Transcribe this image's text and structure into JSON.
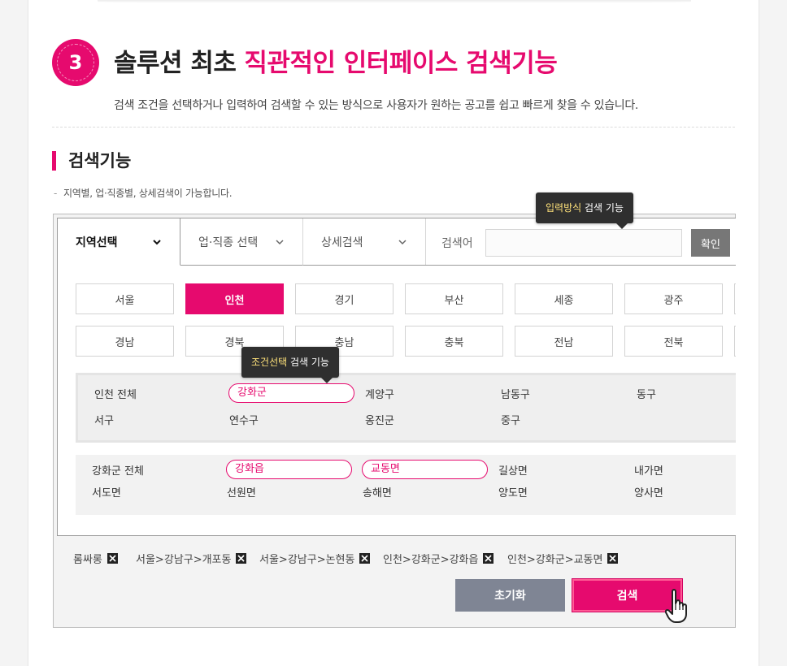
{
  "header": {
    "step_number": "3",
    "title_dark": "솔루션 최초",
    "title_accent": "직관적인 인터페이스 검색기능",
    "description": "검색 조건을 선택하거나 입력하여 검색할 수 있는 방식으로 사용자가 원하는 공고를 쉽고 빠르게 찾을 수 있습니다."
  },
  "section": {
    "title": "검색기능",
    "subtitle": "지역별, 업·직종별, 상세검색이 가능합니다."
  },
  "tabs": [
    {
      "label": "지역선택"
    },
    {
      "label": "업·직종 선택"
    },
    {
      "label": "상세검색"
    }
  ],
  "search": {
    "label": "검색어",
    "value": "",
    "placeholder": "",
    "confirm_label": "확인"
  },
  "tooltip_input": {
    "highlight": "입력방식",
    "text": " 검색 기능"
  },
  "tooltip_select": {
    "highlight": "조건선택",
    "text": " 검색 기능"
  },
  "regions": [
    "서울",
    "인천",
    "경기",
    "부산",
    "세종",
    "광주",
    "경남",
    "경북",
    "충남",
    "충북",
    "전남",
    "전북"
  ],
  "selected_region": "인천",
  "districts": [
    "인천 전체",
    "강화군",
    "계양구",
    "남동구",
    "동구",
    "서구",
    "연수구",
    "옹진군",
    "중구"
  ],
  "selected_district": "강화군",
  "subdistricts": [
    "강화군 전체",
    "강화읍",
    "교동면",
    "길상면",
    "내가면",
    "서도면",
    "선원면",
    "송해면",
    "양도면",
    "양사면"
  ],
  "selected_subdistricts": [
    "강화읍",
    "교동면"
  ],
  "chips": [
    "롬싸롱",
    "서울>강남구>개포동",
    "서울>강남구>논현동",
    "인천>강화군>강화읍",
    "인천>강화군>교동면"
  ],
  "actions": {
    "reset_label": "초기화",
    "search_label": "검색"
  },
  "colors": {
    "accent": "#e60a6e",
    "reset": "#7f8594",
    "tooltip": "#2f2f2f",
    "tooltip_highlight": "#ffe27a"
  }
}
